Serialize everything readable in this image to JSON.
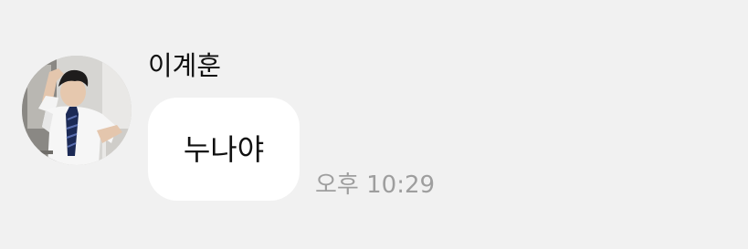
{
  "message": {
    "sender_name": "이계훈",
    "text": "누나야",
    "time": "오후 10:29"
  },
  "colors": {
    "background": "#f1f1f1",
    "bubble": "#ffffff",
    "timestamp": "#9e9e9e"
  }
}
